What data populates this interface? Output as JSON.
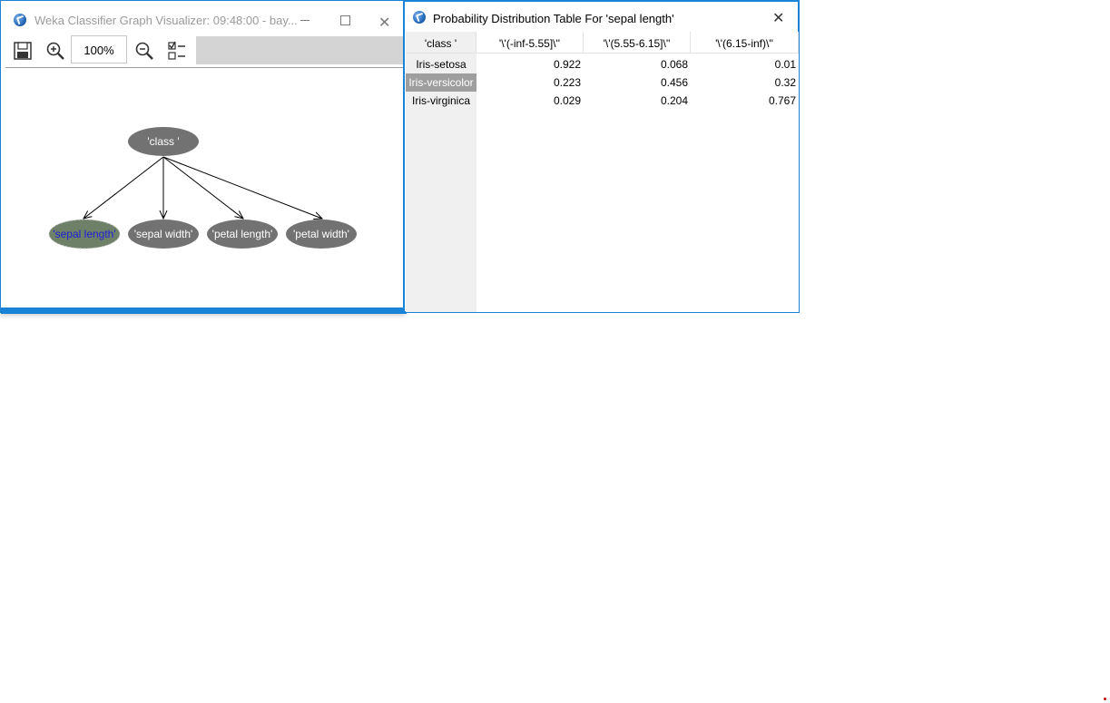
{
  "viz_window": {
    "title": "Weka Classifier Graph Visualizer: 09:48:00 - bay...",
    "zoom_value": "100%"
  },
  "graph": {
    "parent": "'class '",
    "children": [
      "'sepal length'",
      "'sepal width'",
      "'petal length'",
      "'petal width'"
    ],
    "selected_child": "'sepal length'"
  },
  "table_window": {
    "title": "Probability Distribution Table For 'sepal length'",
    "corner_header": "'class '",
    "columns": [
      "'\\'(-inf-5.55]\\''",
      "'\\'(5.55-6.15]\\''",
      "'\\'(6.15-inf)\\''"
    ],
    "rows": [
      {
        "label": "Iris-setosa",
        "values": [
          "0.922",
          "0.068",
          "0.01"
        ]
      },
      {
        "label": "Iris-versicolor",
        "values": [
          "0.223",
          "0.456",
          "0.32"
        ]
      },
      {
        "label": "Iris-virginica",
        "values": [
          "0.029",
          "0.204",
          "0.767"
        ]
      }
    ],
    "selected_row": "Iris-versicolor"
  },
  "colors": {
    "node_fill": "#727272",
    "selected_node_fill": "#6e8068",
    "selected_label": "#1f1fd6",
    "window_border": "#1883d7"
  },
  "icons": [
    "weka-app-icon",
    "save-icon",
    "zoom-in-icon",
    "zoom-out-icon",
    "layout-options-icon",
    "minimize-icon",
    "maximize-icon",
    "close-icon"
  ]
}
